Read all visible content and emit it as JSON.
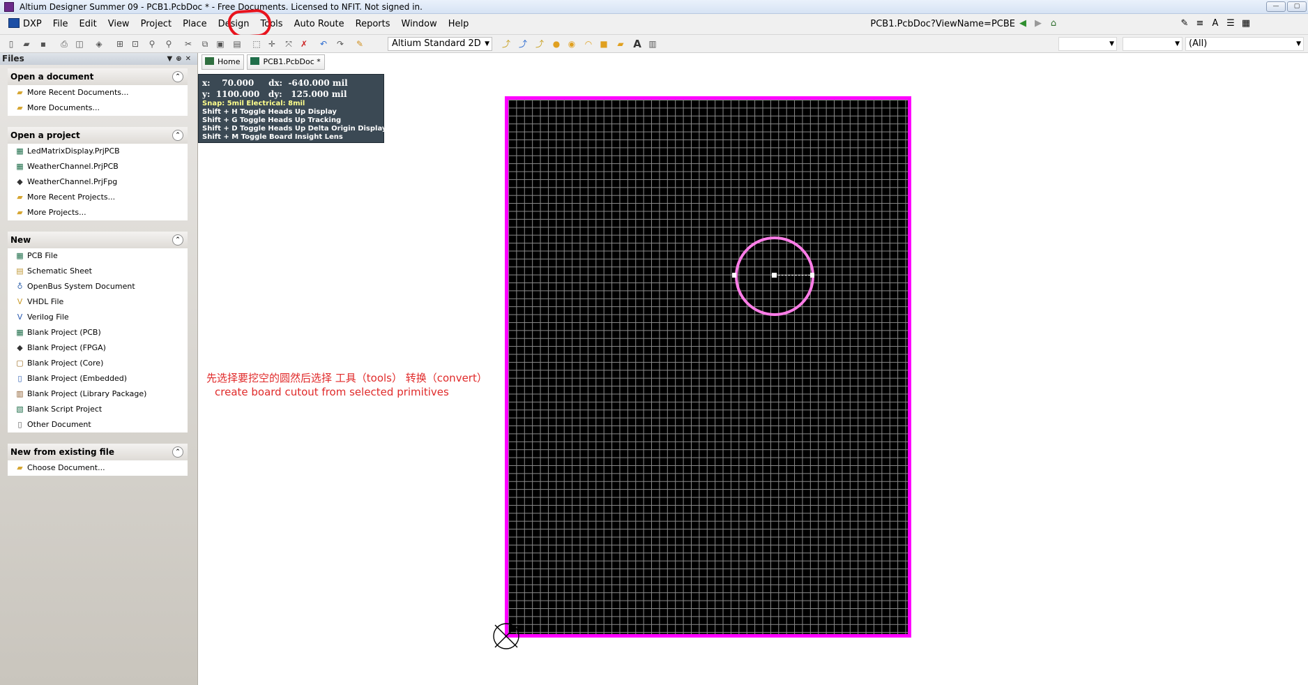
{
  "window": {
    "title": "Altium Designer Summer 09 - PCB1.PcbDoc * - Free Documents. Licensed to NFIT. Not signed in.",
    "controls": [
      "—",
      "▢"
    ]
  },
  "menu": {
    "items": [
      "DXP",
      "File",
      "Edit",
      "View",
      "Project",
      "Place",
      "Design",
      "Tools",
      "Auto Route",
      "Reports",
      "Window",
      "Help"
    ],
    "highlighted": "Tools",
    "highlight_color": "#e8141e",
    "view_name": "PCB1.PcbDoc?ViewName=PCBE"
  },
  "toolbar": {
    "view_mode": "Altium Standard 2D",
    "filter_all": "(All)"
  },
  "files_panel": {
    "title": "Files",
    "sections": [
      {
        "title": "Open a document",
        "items": [
          {
            "label": "More Recent Documents...",
            "icon": "folder-icon"
          },
          {
            "label": "More Documents...",
            "icon": "open-folder-icon"
          }
        ]
      },
      {
        "title": "Open a project",
        "items": [
          {
            "label": "LedMatrixDisplay.PrjPCB",
            "icon": "pcb-project-icon"
          },
          {
            "label": "WeatherChannel.PrjPCB",
            "icon": "pcb-project-icon"
          },
          {
            "label": "WeatherChannel.PrjFpg",
            "icon": "fpga-project-icon"
          },
          {
            "label": "More Recent Projects...",
            "icon": "folder-icon"
          },
          {
            "label": "More Projects...",
            "icon": "open-folder-icon"
          }
        ]
      },
      {
        "title": "New",
        "items": [
          {
            "label": "PCB File",
            "icon": "pcb-file-icon"
          },
          {
            "label": "Schematic Sheet",
            "icon": "schematic-icon"
          },
          {
            "label": "OpenBus System Document",
            "icon": "openbus-icon"
          },
          {
            "label": "VHDL File",
            "icon": "vhdl-icon"
          },
          {
            "label": "Verilog File",
            "icon": "verilog-icon"
          },
          {
            "label": "Blank Project (PCB)",
            "icon": "pcb-project-icon"
          },
          {
            "label": "Blank Project (FPGA)",
            "icon": "fpga-project-icon"
          },
          {
            "label": "Blank Project (Core)",
            "icon": "core-project-icon"
          },
          {
            "label": "Blank Project (Embedded)",
            "icon": "embedded-project-icon"
          },
          {
            "label": "Blank Project (Library Package)",
            "icon": "library-icon"
          },
          {
            "label": "Blank Script Project",
            "icon": "script-icon"
          },
          {
            "label": "Other Document",
            "icon": "document-icon"
          }
        ]
      },
      {
        "title": "New from existing file",
        "items": [
          {
            "label": "Choose Document...",
            "icon": "open-folder-icon"
          }
        ]
      }
    ]
  },
  "tabs": [
    "Home",
    "PCB1.PcbDoc *"
  ],
  "hud": {
    "line1": "x:    70.000     dx:  -640.000 mil",
    "line2": "y:  1100.000   dy:   125.000 mil",
    "snap": "Snap: 5mil Electrical: 8mil",
    "shortcuts": [
      "Shift + H   Toggle Heads Up Display",
      "Shift + G   Toggle Heads Up Tracking",
      "Shift + D   Toggle Heads Up Delta Origin Display",
      "Shift + M  Toggle Board Insight Lens"
    ]
  },
  "annotation": {
    "line1": "先选择要挖空的圆然后选择 工具（tools） 转换（convert）",
    "line2": "create board cutout from selected primitives",
    "color": "#e02a2a"
  },
  "board": {
    "outline_color": "#ff00ff",
    "cutout_color": "#ff7de8"
  }
}
